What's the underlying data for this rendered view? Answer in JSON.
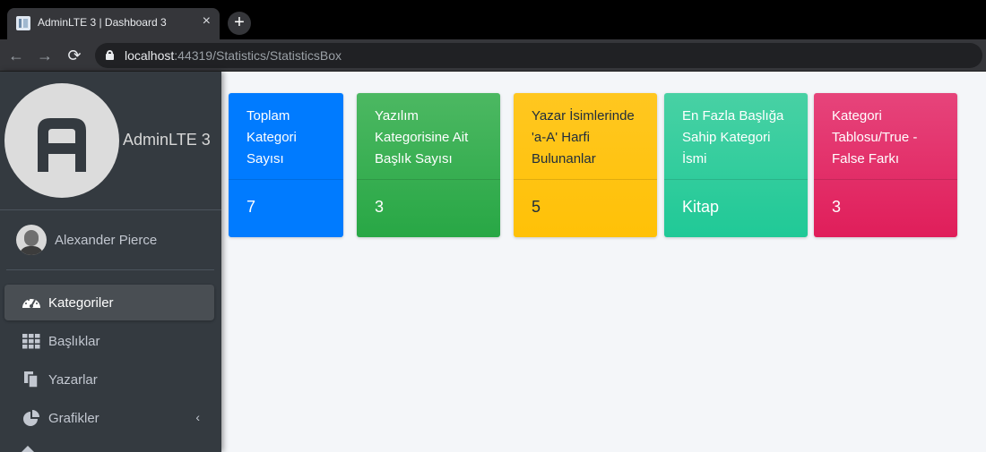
{
  "browser": {
    "tab_title": "AdminLTE 3 | Dashboard 3",
    "close_glyph": "×",
    "newtab_glyph": "+",
    "url_host": "localhost",
    "url_rest": ":44319/Statistics/StatisticsBox",
    "back_glyph": "←",
    "forward_glyph": "→",
    "reload_glyph": "⟳"
  },
  "sidebar": {
    "brand": "AdminLTE 3",
    "user_name": "Alexander Pierce",
    "items": [
      {
        "label": "Kategoriler",
        "icon": "tachometer-icon",
        "active": true
      },
      {
        "label": "Başlıklar",
        "icon": "grid-icon",
        "active": false
      },
      {
        "label": "Yazarlar",
        "icon": "copy-icon",
        "active": false
      },
      {
        "label": "Grafikler",
        "icon": "pie-chart-icon",
        "active": false,
        "chevron": "‹"
      }
    ]
  },
  "cards": [
    {
      "title": "Toplam Kategori Sayısı",
      "value": "7",
      "color": "#007bff"
    },
    {
      "title": "Yazılım Kategorisine Ait Başlık Sayısı",
      "value": "3",
      "color": "#28a745"
    },
    {
      "title": "Yazar İsimlerinde 'a-A' Harfi Bulunanlar",
      "value": "5",
      "color": "#ffc107"
    },
    {
      "title": "En Fazla Başlığa Sahip Kategori İsmi",
      "value": "Kitap",
      "color": "#20c997"
    },
    {
      "title": "Kategori Tablosu/True - False Farkı",
      "value": "3",
      "color": "#e83e8c"
    }
  ]
}
